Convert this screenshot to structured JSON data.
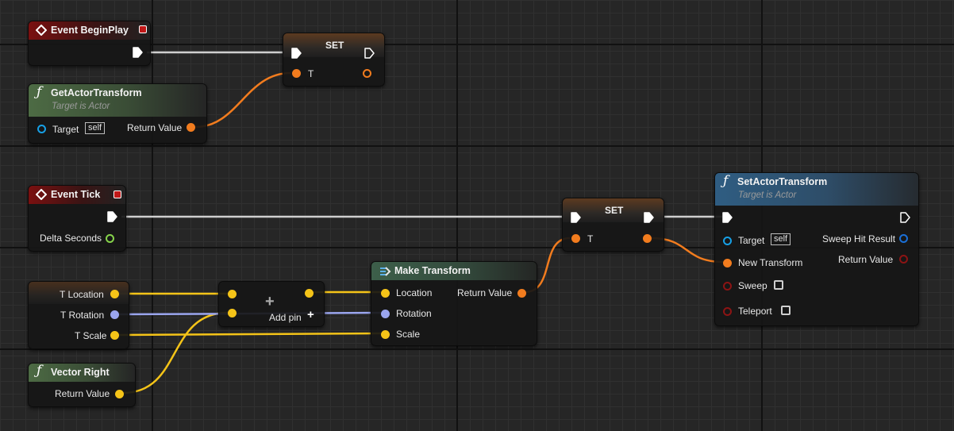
{
  "colors": {
    "exec": "#ffffff",
    "transform": "#f27c1e",
    "vector": "#f5c418",
    "rotator": "#9aa5ee",
    "object": "#17a0e6",
    "float": "#86d44b",
    "hit_result": "#1a6fd6",
    "bool": "#8c1414",
    "wire_gray": "#c8c8c8"
  },
  "event_begin_play": {
    "title": "Event BeginPlay",
    "icon": "diamond-icon"
  },
  "set_top": {
    "title": "SET",
    "pin_t": "T"
  },
  "get_actor_transform": {
    "title": "GetActorTransform",
    "subtitle": "Target is Actor",
    "target_label": "Target",
    "self_label": "self",
    "return_label": "Return Value",
    "icon": "function-icon"
  },
  "event_tick": {
    "title": "Event Tick",
    "delta_label": "Delta Seconds",
    "icon": "diamond-icon"
  },
  "set_mid": {
    "title": "SET",
    "pin_t": "T"
  },
  "set_actor_transform": {
    "title": "SetActorTransform",
    "subtitle": "Target is Actor",
    "target_label": "Target",
    "self_label": "self",
    "new_transform_label": "New Transform",
    "sweep_label": "Sweep",
    "teleport_label": "Teleport",
    "sweep_hit_label": "Sweep Hit Result",
    "return_label": "Return Value",
    "icon": "function-icon"
  },
  "variables": {
    "location": "T Location",
    "rotation": "T Rotation",
    "scale": "T Scale"
  },
  "add_node": {
    "symbol": "+",
    "add_pin_label": "Add pin"
  },
  "make_transform": {
    "title": "Make Transform",
    "location_label": "Location",
    "rotation_label": "Rotation",
    "scale_label": "Scale",
    "return_label": "Return Value",
    "icon": "make-struct-icon"
  },
  "vector_right": {
    "title": "Vector Right",
    "return_label": "Return Value",
    "icon": "function-icon"
  }
}
